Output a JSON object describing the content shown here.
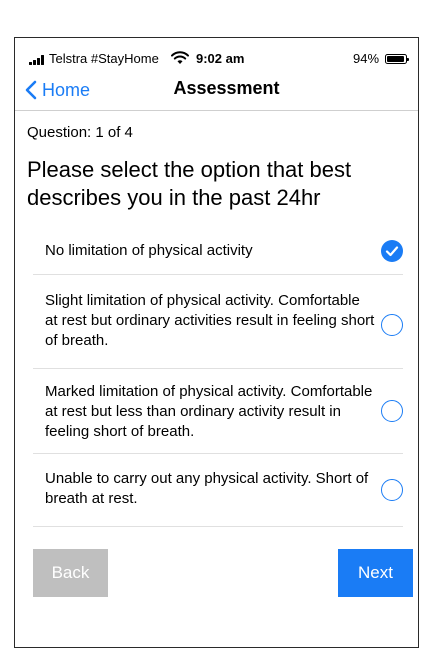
{
  "status_bar": {
    "carrier": "Telstra #StayHome",
    "time": "9:02 am",
    "battery": "94%",
    "battery_level": 0.94
  },
  "nav": {
    "back_label": "Home",
    "title": "Assessment"
  },
  "question": {
    "counter": "Question: 1 of 4",
    "prompt": "Please select the option that best describes you in the past 24hr"
  },
  "options": [
    {
      "label": "No limitation of physical activity",
      "selected": true
    },
    {
      "label": "Slight limitation of physical activity. Comfortable at rest but ordinary activities result in feeling short of breath.",
      "selected": false
    },
    {
      "label": "Marked limitation of physical activity. Comfortable at rest but less than ordinary activity result in feeling short of breath.",
      "selected": false
    },
    {
      "label": "Unable to carry out any physical activity. Short of breath at rest.",
      "selected": false
    }
  ],
  "buttons": {
    "back": "Back",
    "next": "Next"
  },
  "colors": {
    "accent": "#1a7cf5",
    "disabled": "#bfbfbf"
  }
}
